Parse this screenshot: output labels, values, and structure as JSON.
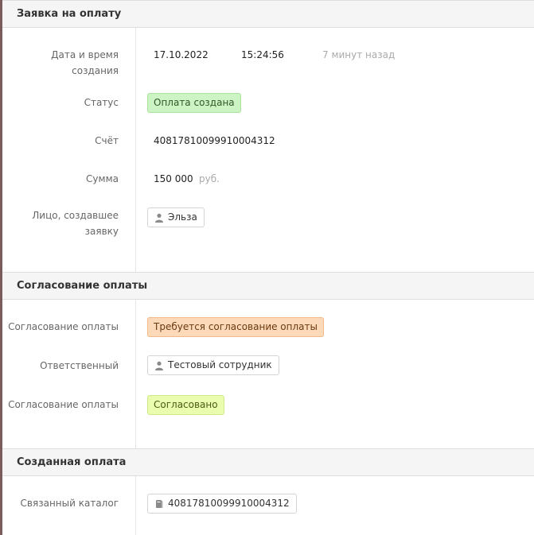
{
  "request": {
    "title": "Заявка на оплату",
    "created_label": "Дата и время создания",
    "created_date": "17.10.2022",
    "created_time": "15:24:56",
    "created_ago": "7 минут назад",
    "status_label": "Статус",
    "status_value": "Оплата создана",
    "account_label": "Счёт",
    "account_value": "40817810099910004312",
    "amount_label": "Сумма",
    "amount_value": "150 000",
    "amount_currency": "руб.",
    "creator_label": "Лицо, создавшее заявку",
    "creator_value": "Эльза"
  },
  "approval": {
    "title": "Согласование оплаты",
    "approval_label_1": "Согласование оплаты",
    "approval_value_1": "Требуется согласование оплаты",
    "responsible_label": "Ответственный",
    "responsible_value": "Тестовый сотрудник",
    "approval_label_2": "Согласование оплаты",
    "approval_value_2": "Согласовано"
  },
  "created_payment": {
    "title": "Созданная оплата",
    "catalog_label": "Связанный каталог",
    "catalog_value": "40817810099910004312"
  },
  "colors": {
    "status_green": "#cdf4c4",
    "status_orange": "#fcd9b8",
    "status_lime": "#eafcae",
    "left_bar": "#7a5c5c",
    "top_accent": "#5aa36a"
  },
  "icons": {
    "user": "user-icon",
    "catalog": "book-icon"
  }
}
